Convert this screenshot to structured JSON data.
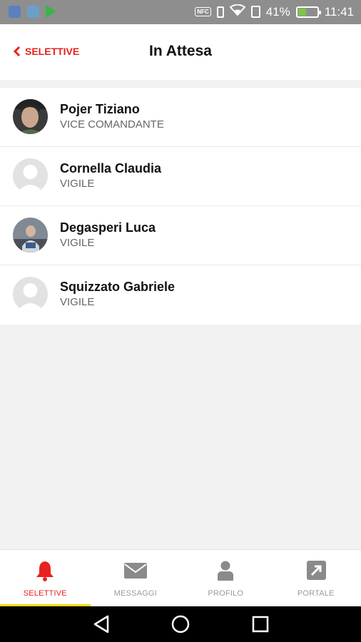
{
  "status_bar": {
    "icons": [
      "bluetooth-icon",
      "gallery-icon",
      "play-store-icon"
    ],
    "nfc_label": "NFC",
    "battery_percent": "41%",
    "battery_level": 0.41,
    "time": "11:41"
  },
  "header": {
    "back_label": "SELETTIVE",
    "title": "In Attesa"
  },
  "members": [
    {
      "name": "Pojer Tiziano",
      "role": "VICE COMANDANTE",
      "avatar": "photo"
    },
    {
      "name": "Cornella Claudia",
      "role": "VIGILE",
      "avatar": "placeholder"
    },
    {
      "name": "Degasperi Luca",
      "role": "VIGILE",
      "avatar": "photo"
    },
    {
      "name": "Squizzato Gabriele",
      "role": "VIGILE",
      "avatar": "placeholder"
    }
  ],
  "tabs": [
    {
      "label": "SELETTIVE",
      "icon": "bell-icon",
      "active": true
    },
    {
      "label": "MESSAGGI",
      "icon": "envelope-icon",
      "active": false
    },
    {
      "label": "PROFILO",
      "icon": "person-icon",
      "active": false
    },
    {
      "label": "PORTALE",
      "icon": "external-link-icon",
      "active": false
    }
  ],
  "colors": {
    "accent": "#e8211f",
    "tab_indicator": "#f5d800",
    "inactive_icon": "#8a8a8a"
  }
}
